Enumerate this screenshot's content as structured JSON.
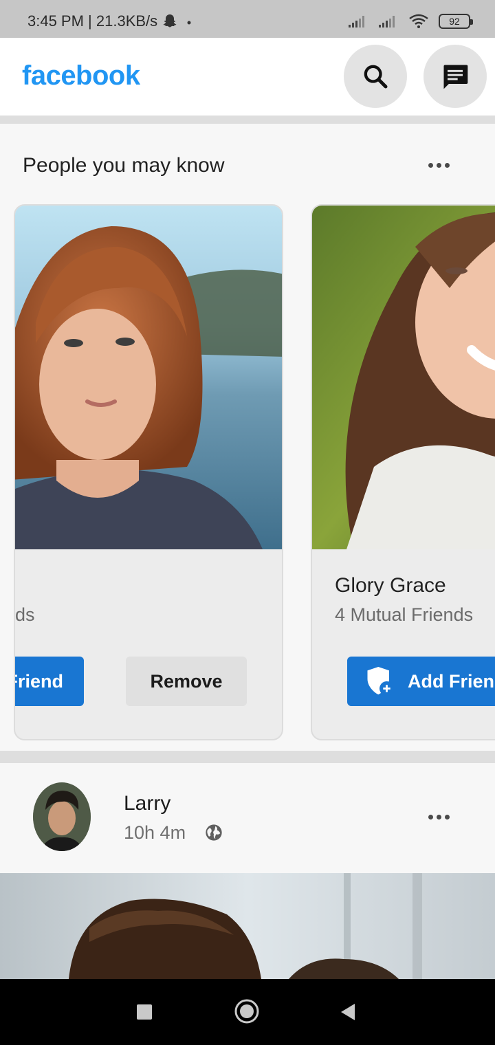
{
  "status_bar": {
    "time_speed": "3:45 PM | 21.3KB/s",
    "battery": "92",
    "icons": [
      "snapchat-ghost-icon",
      "dot-icon",
      "signal-icon",
      "signal-icon",
      "wifi-icon",
      "battery-icon"
    ]
  },
  "app_bar": {
    "logo": "facebook",
    "search_icon": "search-icon",
    "messenger_icon": "message-icon"
  },
  "colors": {
    "brand": "#2196f3",
    "primary_button": "#1976d2",
    "secondary_button": "#e0e0e0"
  },
  "people_you_may_know": {
    "title": "People you may know",
    "cards": [
      {
        "name": "",
        "mutual_visible": "ends",
        "add_label_visible": "l Friend",
        "remove_label": "Remove"
      },
      {
        "name": "Glory Grace",
        "mutual": "4 Mutual Friends",
        "add_label": "Add Friend"
      }
    ]
  },
  "post": {
    "author": "Larry",
    "time": "10h 4m",
    "privacy_icon": "globe-icon"
  },
  "nav_bar": {
    "buttons": [
      "recents-square-icon",
      "home-circle-icon",
      "back-triangle-icon"
    ]
  }
}
